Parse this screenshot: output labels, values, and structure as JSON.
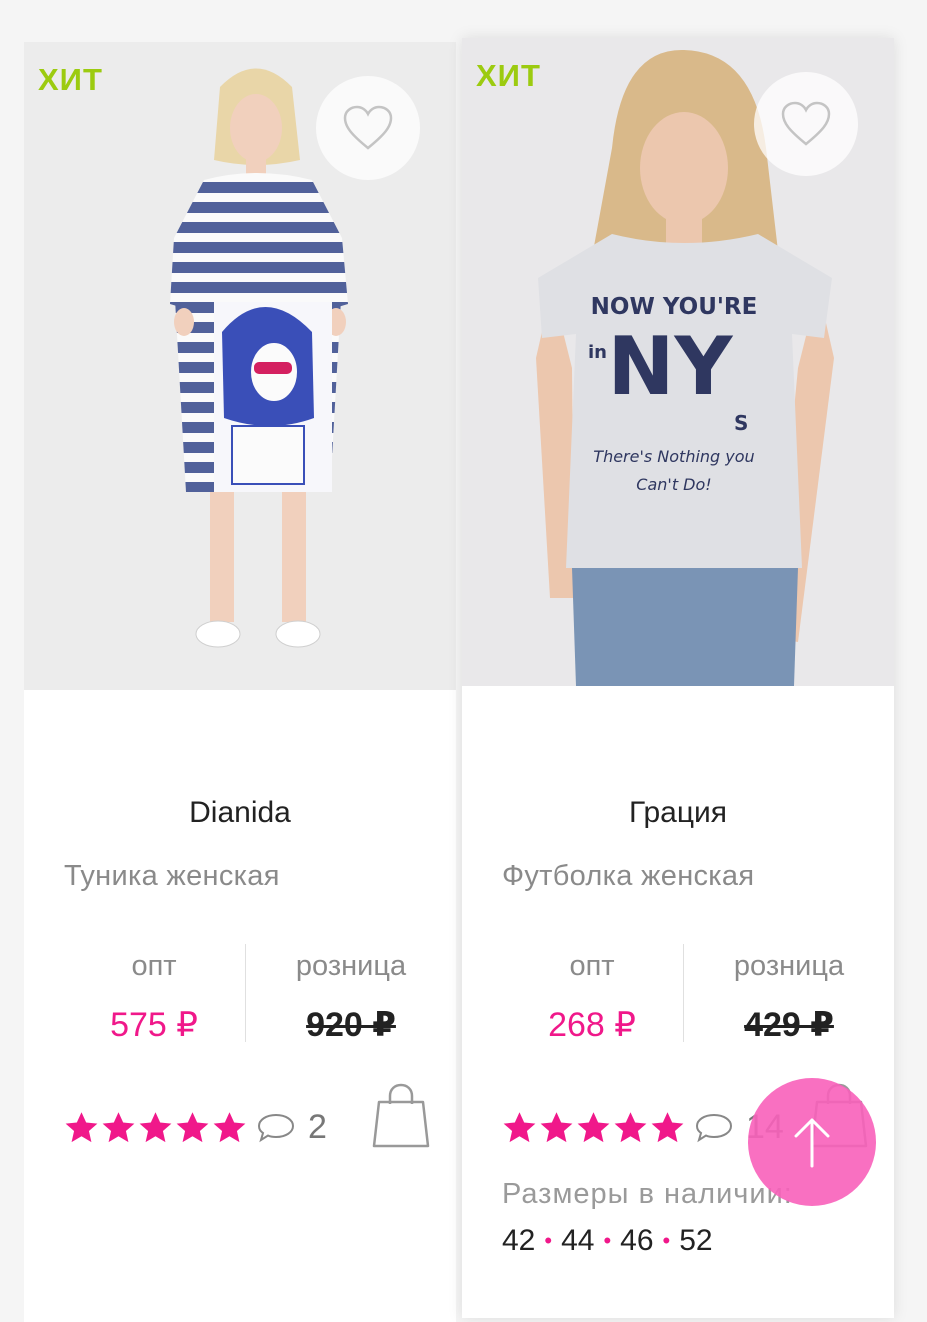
{
  "theme": {
    "accent": "#f0188a",
    "badge_color": "#9ccb10",
    "star_color": "#f0188a"
  },
  "products": [
    {
      "badge": "ХИТ",
      "brand": "Dianida",
      "name": "Туника женская",
      "opt_label": "опт",
      "opt_price": "575 ₽",
      "retail_label": "розница",
      "retail_price": "920 ₽",
      "rating": 5,
      "comments": "2",
      "image": "woman-in-striped-tunic-dress",
      "icons": {
        "favorite": "heart-icon",
        "comment": "comment-icon",
        "cart": "shopping-bag-icon"
      }
    },
    {
      "badge": "ХИТ",
      "brand": "Грация",
      "name": "Футболка женская",
      "opt_label": "опт",
      "opt_price": "268 ₽",
      "retail_label": "розница",
      "retail_price": "429 ₽",
      "rating": 5,
      "comments": "14",
      "sizes_title": "Размеры в наличии:",
      "sizes": [
        "42",
        "44",
        "46",
        "52"
      ],
      "image": "woman-in-grey-tshirt-now-youre-in-ny",
      "shirt_text": [
        "NOW YOU'RE",
        "in",
        "NY",
        "S",
        "There's Nothing you",
        "Can't Do!"
      ],
      "icons": {
        "favorite": "heart-icon",
        "comment": "comment-icon",
        "cart": "shopping-bag-icon"
      }
    }
  ],
  "scroll_top_icon": "arrow-up-icon"
}
